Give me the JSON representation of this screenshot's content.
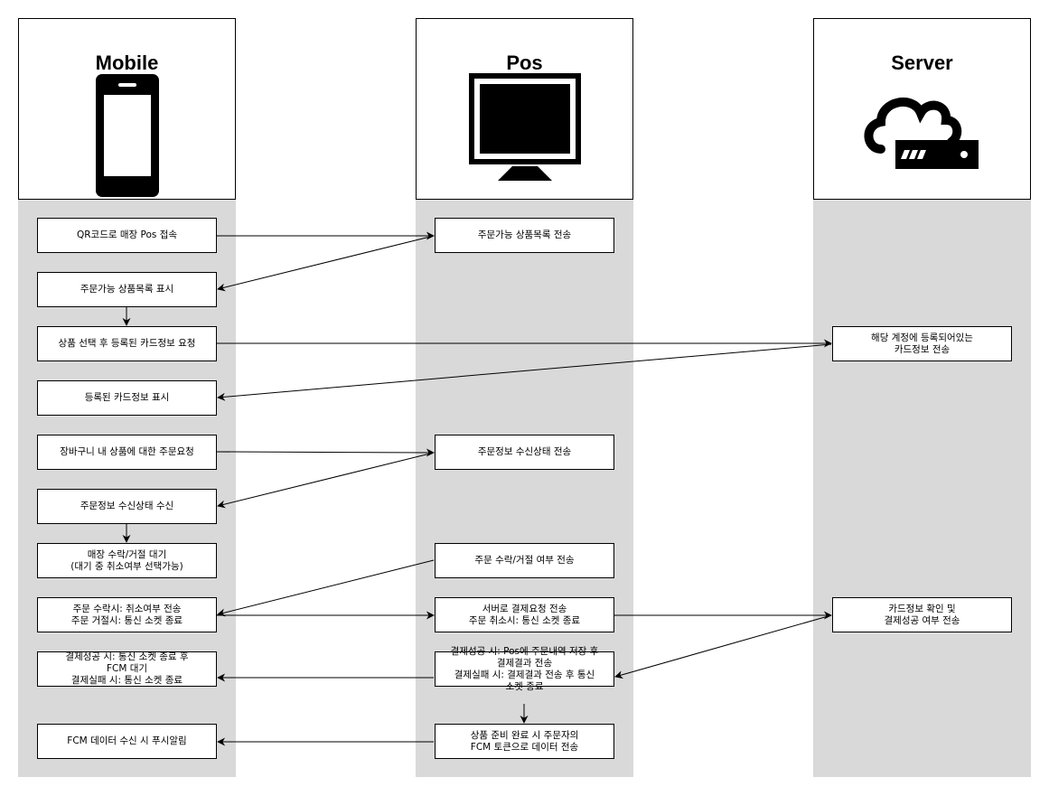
{
  "lanes": {
    "mobile": {
      "title": "Mobile"
    },
    "pos": {
      "title": "Pos"
    },
    "server": {
      "title": "Server"
    }
  },
  "boxes": {
    "m1": "QR코드로 매장 Pos 접속",
    "m2": "주문가능 상품목록 표시",
    "m3": "상품 선택 후 등록된 카드정보 요청",
    "m4": "등록된 카드정보 표시",
    "m5": "장바구니 내 상품에 대한 주문요청",
    "m6": "주문정보 수신상태 수신",
    "m7": "매장 수락/거절 대기\n(대기 중 취소여부 선택가능)",
    "m8": "주문 수락시: 취소여부 전송\n주문 거절시: 통신 소켓 종료",
    "m9": "결제성공 시: 통신 소켓 종료 후\nFCM 대기\n결제실패 시: 통신 소켓 종료",
    "m10": "FCM 데이터 수신 시 푸시알림",
    "p1": "주문가능 상품목록 전송",
    "p2": "주문정보 수신상태 전송",
    "p3": "주문 수락/거절 여부 전송",
    "p4": "서버로 결제요청 전송\n주문 취소시: 통신 소켓 종료",
    "p5": "결제성공 시: Pos에 주문내역 저장 후\n결제결과 전송\n결제실패 시: 결제결과 전송 후 통신\n소켓 종료",
    "p6": "상품 준비 완료 시 주문자의\nFCM 토큰으로 데이터 전송",
    "s1": "해당 계정에 등록되어있는\n카드정보 전송",
    "s2": "카드정보 확인 및\n결제성공 여부 전송"
  },
  "icons": {
    "mobile": "mobile-phone-icon",
    "pos": "monitor-icon",
    "server": "cloud-server-icon"
  }
}
